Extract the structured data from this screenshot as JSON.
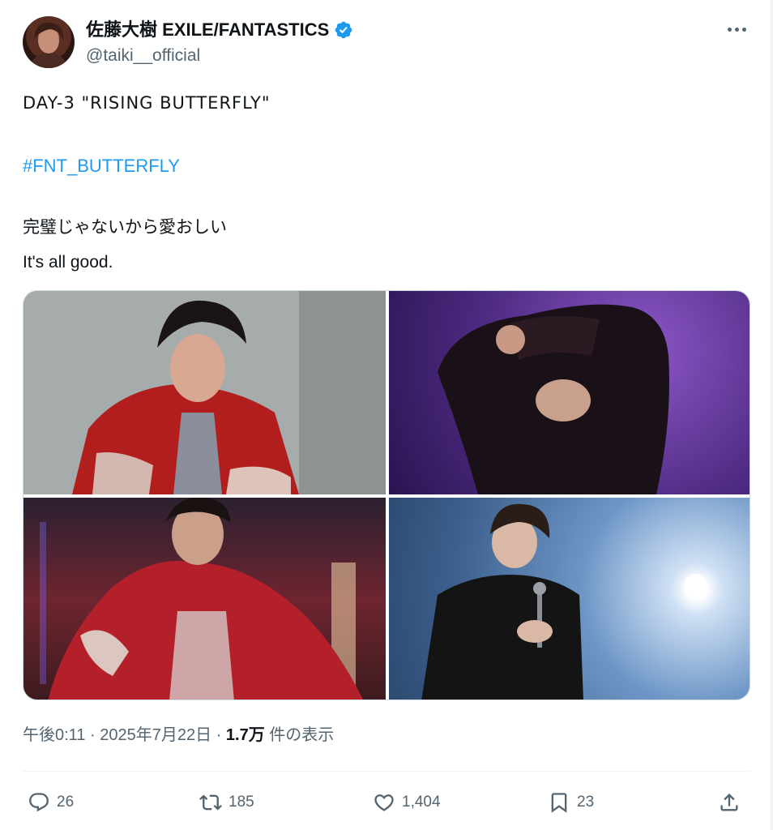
{
  "author": {
    "display_name": "佐藤大樹 EXILE/FANTASTICS",
    "handle": "@taiki__official"
  },
  "tweet": {
    "line1": "DAY-3 \"RISING BUTTERFLY\"",
    "hashtag": "#FNT_BUTTERFLY",
    "line3": "完璧じゃないから愛おしい",
    "line4": "It's all good."
  },
  "meta": {
    "time": "午後0:11",
    "sep1": " · ",
    "date": "2025年7月22日",
    "sep2": " · ",
    "views": "1.7万",
    "views_label": " 件の表示"
  },
  "actions": {
    "replies": "26",
    "retweets": "185",
    "likes": "1,404",
    "bookmarks": "23"
  },
  "colors": {
    "link": "#1d9bf0",
    "verified": "#1d9bf0",
    "muted": "#536471"
  }
}
